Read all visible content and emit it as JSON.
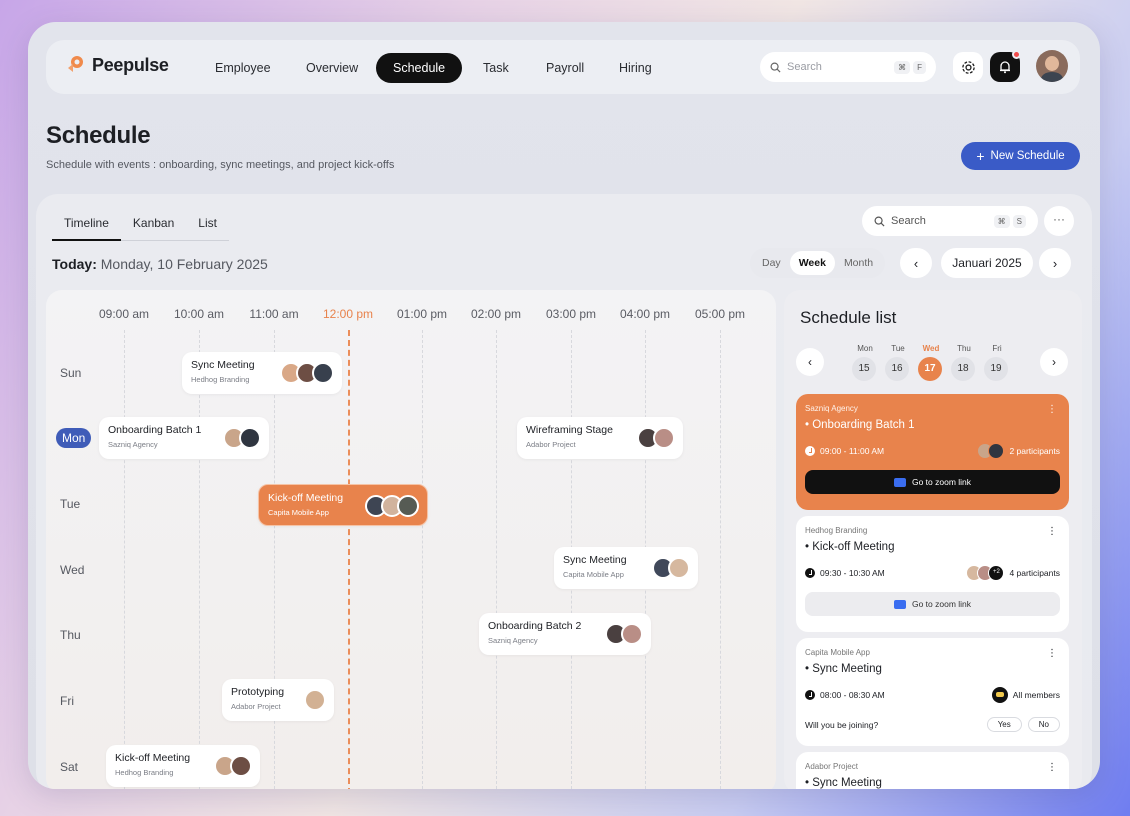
{
  "brand": {
    "name": "Peepulse"
  },
  "nav": {
    "items": [
      {
        "label": "Employee",
        "active": false
      },
      {
        "label": "Overview",
        "active": false
      },
      {
        "label": "Schedule",
        "active": true
      },
      {
        "label": "Task",
        "active": false
      },
      {
        "label": "Payroll",
        "active": false
      },
      {
        "label": "Hiring",
        "active": false
      }
    ],
    "search_placeholder": "Search",
    "search_shortcut": [
      "⌘",
      "F"
    ]
  },
  "header": {
    "title": "Schedule",
    "subtitle": "Schedule with events : onboarding, sync meetings, and project kick-offs",
    "new_button": "New Schedule"
  },
  "view_tabs": [
    {
      "label": "Timeline",
      "active": true
    },
    {
      "label": "Kanban",
      "active": false
    },
    {
      "label": "List",
      "active": false
    }
  ],
  "panel_search": {
    "placeholder": "Search",
    "shortcut": [
      "⌘",
      "S"
    ]
  },
  "more_label": "···",
  "today": {
    "label": "Today:",
    "date": "Monday, 10 February 2025"
  },
  "range_tabs": [
    {
      "label": "Day",
      "active": false
    },
    {
      "label": "Week",
      "active": true
    },
    {
      "label": "Month",
      "active": false
    }
  ],
  "month": "Januari 2025",
  "timeline": {
    "hours": [
      "09:00 am",
      "10:00 am",
      "11:00 am",
      "12:00 pm",
      "01:00 pm",
      "02:00 pm",
      "03:00 pm",
      "04:00 pm",
      "05:00 pm"
    ],
    "current_hour_index": 3,
    "days": [
      "Sun",
      "Mon",
      "Tue",
      "Wed",
      "Thu",
      "Fri",
      "Sat"
    ],
    "active_day": "Mon",
    "events": [
      {
        "title": "Sync Meeting",
        "org": "Hedhog Branding",
        "day": "Sun",
        "highlight": false,
        "avatars": 3
      },
      {
        "title": "Onboarding Batch 1",
        "org": "Sazniq Agency",
        "day": "Mon",
        "highlight": false,
        "avatars": 2
      },
      {
        "title": "Wireframing Stage",
        "org": "Adabor Project",
        "day": "Mon",
        "highlight": false,
        "avatars": 2
      },
      {
        "title": "Kick-off Meeting",
        "org": "Capita Mobile App",
        "day": "Tue",
        "highlight": true,
        "avatars": 3
      },
      {
        "title": "Sync Meeting",
        "org": "Capita Mobile App",
        "day": "Wed",
        "highlight": false,
        "avatars": 2
      },
      {
        "title": "Onboarding Batch 2",
        "org": "Sazniq Agency",
        "day": "Thu",
        "highlight": false,
        "avatars": 2
      },
      {
        "title": "Prototyping",
        "org": "Adabor Project",
        "day": "Fri",
        "highlight": false,
        "avatars": 1
      },
      {
        "title": "Kick-off Meeting",
        "org": "Hedhog Branding",
        "day": "Sat",
        "highlight": false,
        "avatars": 2
      }
    ]
  },
  "schedule_list": {
    "title": "Schedule list",
    "week": [
      {
        "name": "Mon",
        "day": "15",
        "active": false
      },
      {
        "name": "Tue",
        "day": "16",
        "active": false
      },
      {
        "name": "Wed",
        "day": "17",
        "active": true
      },
      {
        "name": "Thu",
        "day": "18",
        "active": false
      },
      {
        "name": "Fri",
        "day": "19",
        "active": false
      }
    ],
    "cards": [
      {
        "org": "Sazniq Agency",
        "title": "• Onboarding Batch 1",
        "time": "09:00 - 11:00 AM",
        "participants": "2 participants",
        "zoom": "Go to zoom link"
      },
      {
        "org": "Hedhog Branding",
        "title": "• Kick-off Meeting",
        "time": "09:30 - 10:30 AM",
        "participants": "4 participants",
        "extra": "+2",
        "zoom": "Go to zoom link"
      },
      {
        "org": "Capita Mobile App",
        "title": "• Sync Meeting",
        "time": "08:00 - 08:30 AM",
        "participants": "All members",
        "question": "Will you be joining?",
        "yes": "Yes",
        "no": "No"
      },
      {
        "org": "Adabor Project",
        "title": "• Sync Meeting"
      }
    ]
  },
  "colors": {
    "accent": "#e8834c",
    "primary": "#3a5bc7",
    "active_nav": "#111111"
  }
}
